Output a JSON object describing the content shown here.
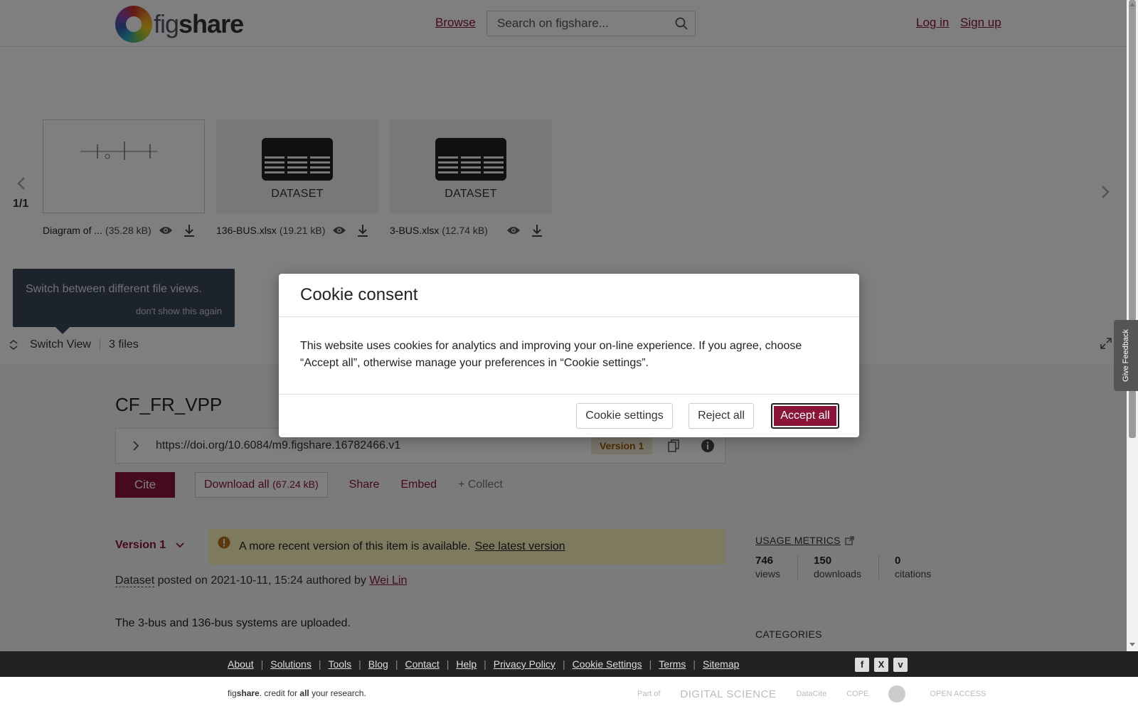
{
  "header": {
    "logo_text_a": "fig",
    "logo_text_b": "share",
    "browse": "Browse",
    "search_placeholder": "Search on figshare...",
    "login": "Log in",
    "signup": "Sign up"
  },
  "viewer": {
    "files": [
      {
        "name": "Diagram of ...",
        "size": "(35.28 kB)",
        "type": ""
      },
      {
        "name": "136-BUS.xlsx",
        "size": "(19.21 kB)",
        "type": "DATASET"
      },
      {
        "name": "3-BUS.xlsx",
        "size": "(12.74 kB)",
        "type": "DATASET"
      }
    ],
    "pager": "1/1",
    "tooltip_text": "Switch between different file views.",
    "tooltip_dismiss": "don't show this again",
    "switch_view": "Switch View",
    "file_count": "3 files"
  },
  "item": {
    "title": "CF_FR_VPP",
    "doi": "https://doi.org/10.6084/m9.figshare.16782466.v1",
    "version_badge": "Version 1",
    "cite": "Cite",
    "download_all": "Download all",
    "download_size": "(67.24 kB)",
    "share": "Share",
    "embed": "Embed",
    "collect": "+ Collect",
    "version_select": "Version 1",
    "notice_text": "A more recent version of this item is available.",
    "notice_link": "See latest version",
    "meta_type": "Dataset",
    "meta_posted": "posted on 2021-10-11, 15:24 authored by",
    "meta_author": "Wei Lin",
    "description": "The 3-bus and 136-bus systems are uploaded."
  },
  "sidebar": {
    "usage_title": "USAGE METRICS",
    "metrics": [
      {
        "value": "746",
        "label": "views"
      },
      {
        "value": "150",
        "label": "downloads"
      },
      {
        "value": "0",
        "label": "citations"
      }
    ],
    "categories_title": "CATEGORIES"
  },
  "feedback": "Give Feedback",
  "cookie_modal": {
    "title": "Cookie consent",
    "body": "This website uses cookies for analytics and improving your on-line experience. If you agree, choose “Accept all”, otherwise manage your preferences in “Cookie settings”.",
    "settings": "Cookie settings",
    "reject": "Reject all",
    "accept": "Accept all"
  },
  "footer": {
    "links": [
      "About",
      "Solutions",
      "Tools",
      "Blog",
      "Contact",
      "Help",
      "Privacy Policy",
      "Cookie Settings",
      "Terms",
      "Sitemap"
    ],
    "social": [
      "f",
      "X",
      "v"
    ],
    "tagline_a": "fig",
    "tagline_b": "share",
    "tagline_c": ". credit for ",
    "tagline_d": "all",
    "tagline_e": " your research.",
    "partner_part_of": "Part of",
    "partner_ds": "DIGITAL SCIENCE",
    "partner_datacite": "DataCite",
    "partner_cope": "COPE",
    "partner_oa": "OPEN ACCESS"
  },
  "colors": {
    "brand": "#8a1538",
    "notice_bg": "#faf5bf",
    "version_badge_bg": "#f3e9d4"
  }
}
